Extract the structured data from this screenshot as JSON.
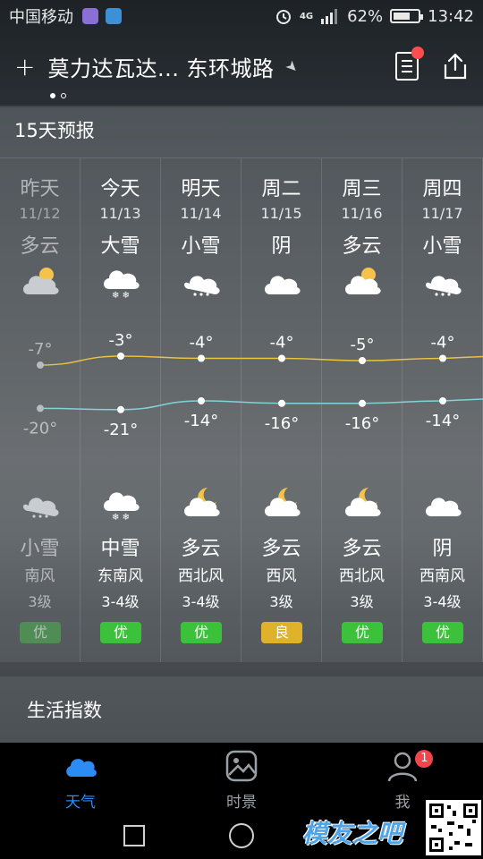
{
  "status": {
    "carrier": "中国移动",
    "network": "4G",
    "battery": "62%",
    "time": "13:42"
  },
  "header": {
    "plus": "+",
    "location": "莫力达瓦达... 东环城路"
  },
  "forecast": {
    "title": "15天预报",
    "days": [
      {
        "name": "昨天",
        "date": "11/12",
        "cond": "多云",
        "high": "-7°",
        "low": "-20°",
        "night_cond": "小雪",
        "wind": "南风",
        "level": "3级",
        "aqi": "优",
        "aqi_color": "#4caf50"
      },
      {
        "name": "今天",
        "date": "11/13",
        "cond": "大雪",
        "high": "-3°",
        "low": "-21°",
        "night_cond": "中雪",
        "wind": "东南风",
        "level": "3-4级",
        "aqi": "优",
        "aqi_color": "#3cc13b"
      },
      {
        "name": "明天",
        "date": "11/14",
        "cond": "小雪",
        "high": "-4°",
        "low": "-14°",
        "night_cond": "多云",
        "wind": "西北风",
        "level": "3-4级",
        "aqi": "优",
        "aqi_color": "#3cc13b"
      },
      {
        "name": "周二",
        "date": "11/15",
        "cond": "阴",
        "high": "-4°",
        "low": "-16°",
        "night_cond": "多云",
        "wind": "西风",
        "level": "3级",
        "aqi": "良",
        "aqi_color": "#e0b12a"
      },
      {
        "name": "周三",
        "date": "11/16",
        "cond": "多云",
        "high": "-5°",
        "low": "-16°",
        "night_cond": "多云",
        "wind": "西北风",
        "level": "3级",
        "aqi": "优",
        "aqi_color": "#3cc13b"
      },
      {
        "name": "周四",
        "date": "11/17",
        "cond": "小雪",
        "high": "-4°",
        "low": "-14°",
        "night_cond": "阴",
        "wind": "西南风",
        "level": "3-4级",
        "aqi": "优",
        "aqi_color": "#3cc13b"
      }
    ],
    "highs": [
      -7,
      -3,
      -4,
      -4,
      -5,
      -4
    ],
    "lows": [
      -20,
      -21,
      -14,
      -16,
      -16,
      -14
    ],
    "high_color": "#e9c43c",
    "low_color": "#7fd4d9"
  },
  "life_index": {
    "title": "生活指数"
  },
  "tabs": [
    {
      "label": "天气"
    },
    {
      "label": "时景"
    },
    {
      "label": "我",
      "badge": "1"
    }
  ],
  "colors": {
    "accent": "#2b8cf3"
  }
}
